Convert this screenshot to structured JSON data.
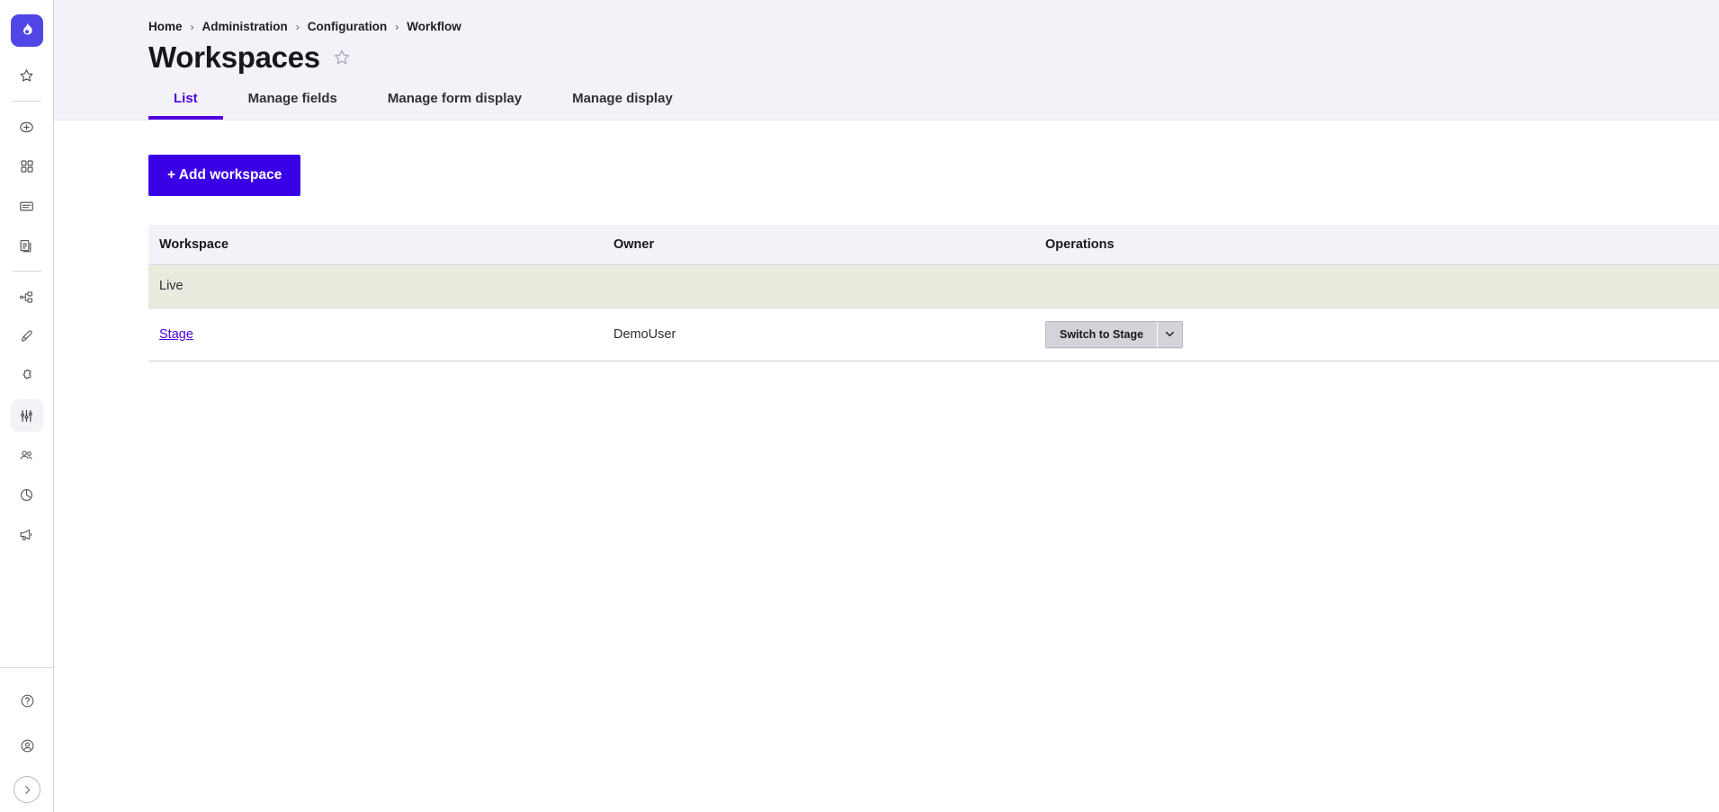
{
  "sidebar": {
    "logo": {
      "name": "drupal-logo",
      "label": "Drupal"
    },
    "top_items": [
      {
        "icon": "star-icon",
        "label": "Shortcuts"
      }
    ],
    "items": [
      {
        "icon": "plus-circle-icon",
        "label": "Create"
      },
      {
        "icon": "grid-icon",
        "label": "Content blocks"
      },
      {
        "icon": "list-icon",
        "label": "Content"
      },
      {
        "icon": "files-icon",
        "label": "Files"
      }
    ],
    "items2": [
      {
        "icon": "sitemap-icon",
        "label": "Structure"
      },
      {
        "icon": "paintbrush-icon",
        "label": "Appearance"
      },
      {
        "icon": "puzzle-icon",
        "label": "Extend"
      },
      {
        "icon": "sliders-icon",
        "label": "Configuration",
        "active": true
      },
      {
        "icon": "people-icon",
        "label": "People"
      },
      {
        "icon": "pie-chart-icon",
        "label": "Reports"
      },
      {
        "icon": "megaphone-icon",
        "label": "Announcements"
      }
    ],
    "bottom_items": [
      {
        "icon": "help-circle-icon",
        "label": "Help"
      },
      {
        "icon": "user-circle-icon",
        "label": "Account"
      }
    ],
    "expand": {
      "icon": "chevron-right-icon",
      "label": "Expand sidebar"
    }
  },
  "breadcrumb": {
    "items": [
      {
        "label": "Home"
      },
      {
        "label": "Administration"
      },
      {
        "label": "Configuration"
      },
      {
        "label": "Workflow"
      }
    ],
    "separator": "›"
  },
  "header": {
    "title": "Workspaces",
    "star_label": "Add to shortcuts"
  },
  "tabs": [
    {
      "label": "List",
      "active": true
    },
    {
      "label": "Manage fields",
      "active": false
    },
    {
      "label": "Manage form display",
      "active": false
    },
    {
      "label": "Manage display",
      "active": false
    }
  ],
  "actions": {
    "add_workspace": "+ Add workspace"
  },
  "table": {
    "columns": [
      "Workspace",
      "Owner",
      "Operations"
    ],
    "rows": [
      {
        "workspace": "Live",
        "workspace_is_link": false,
        "owner": "",
        "operations": null,
        "highlight": true
      },
      {
        "workspace": "Stage",
        "workspace_is_link": true,
        "owner": "DemoUser",
        "operations": {
          "primary_label": "Switch to Stage",
          "toggle_icon": "chevron-down-icon"
        },
        "highlight": false
      }
    ]
  },
  "colors": {
    "accent_purple": "#5103e0",
    "button_purple": "#3a00e6",
    "logo_indigo": "#4f46e5",
    "header_bg": "#f3f2f8",
    "row_highlight": "#eaeade",
    "op_button_bg": "#d3d3da"
  }
}
